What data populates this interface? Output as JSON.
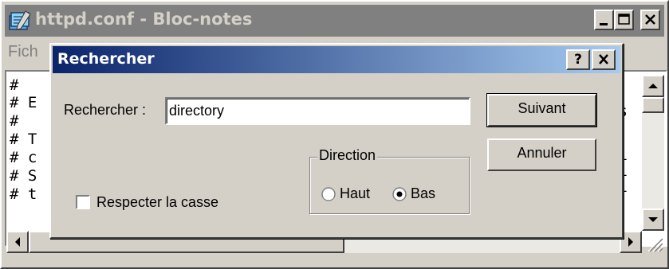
{
  "notepad": {
    "title": "httpd.conf - Bloc-notes",
    "menu_file": "Fich",
    "lines_left": [
      "#",
      "# E",
      "#",
      "# T",
      "# c",
      "# S",
      "# t"
    ],
    "lines_right": [
      "s",
      "fi",
      "i",
      "ai"
    ]
  },
  "find_dialog": {
    "title": "Rechercher",
    "help_label": "?",
    "close_label": "×",
    "search_label": "Rechercher :",
    "search_value": "directory",
    "next_button": "Suivant",
    "cancel_button": "Annuler",
    "direction_label": "Direction",
    "direction_up": "Haut",
    "direction_down": "Bas",
    "direction_selected": "Bas",
    "match_case_label": "Respecter la casse",
    "match_case_checked": false
  },
  "colors": {
    "title_active_start": "#0a246a",
    "title_active_end": "#a6caf0",
    "title_inactive": "#808080",
    "face": "#d4d0c8"
  }
}
